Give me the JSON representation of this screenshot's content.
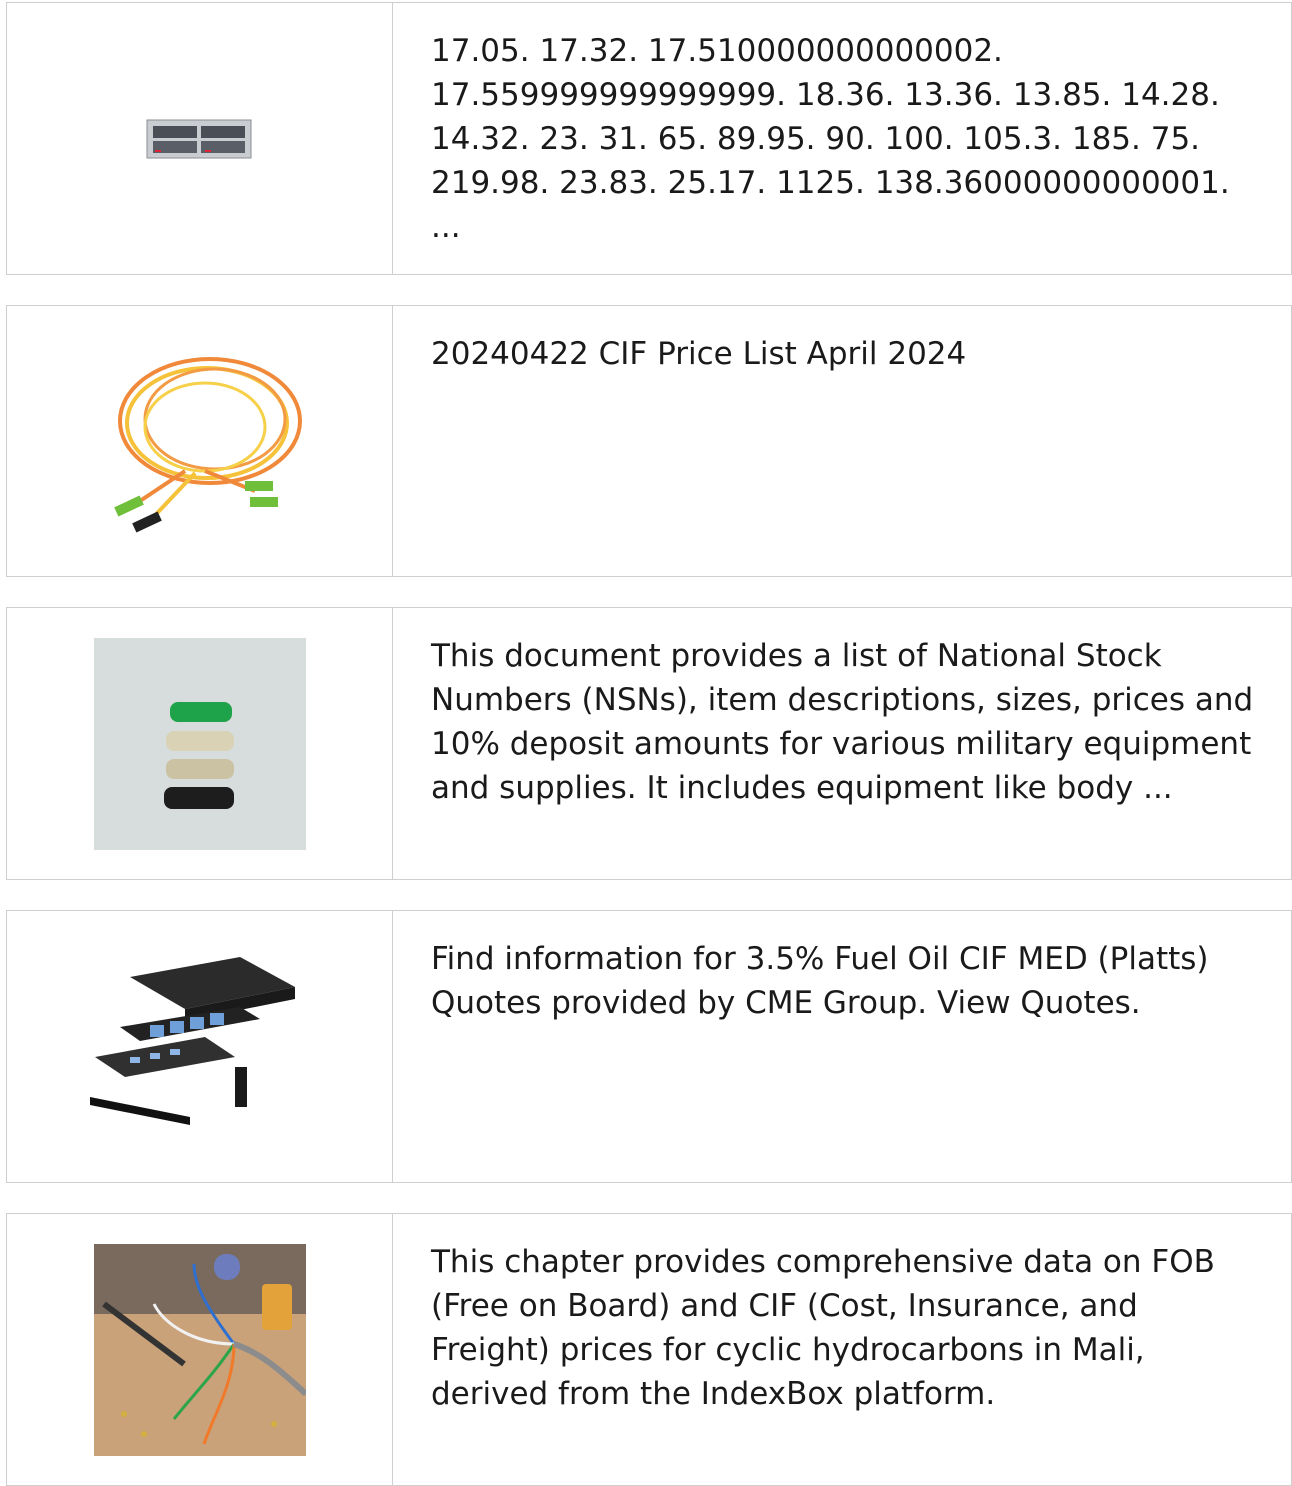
{
  "results": [
    {
      "image": "network-switch-module",
      "snippet": "17.05. 17.32. 17.510000000000002. 17.559999999999999. 18.36. 13.36. 13.85. 14.28. 14.32. 23. 31. 65. 89.95. 90. 100. 105.3. 185. 75. 219.98. 23.83. 25.17. 1125. 138.36000000000001. ..."
    },
    {
      "image": "fiber-optic-patch-cable",
      "snippet": "20240422 CIF Price List April 2024"
    },
    {
      "image": "connector-boot-sleeves",
      "snippet": "This document provides a list of National Stock Numbers (NSNs), item descriptions, sizes, prices and 10% deposit amounts for various military equipment and supplies. It includes equipment like body ..."
    },
    {
      "image": "fiber-patch-panel-enclosure",
      "snippet": "Find information for 3.5% Fuel Oil CIF MED (Platts) Quotes provided by CME Group. View Quotes."
    },
    {
      "image": "wires-on-workbench",
      "snippet": "This chapter provides comprehensive data on FOB (Free on Board) and CIF (Cost, Insurance, and Freight) prices for cyclic hydrocarbons in Mali, derived from the IndexBox platform."
    }
  ]
}
